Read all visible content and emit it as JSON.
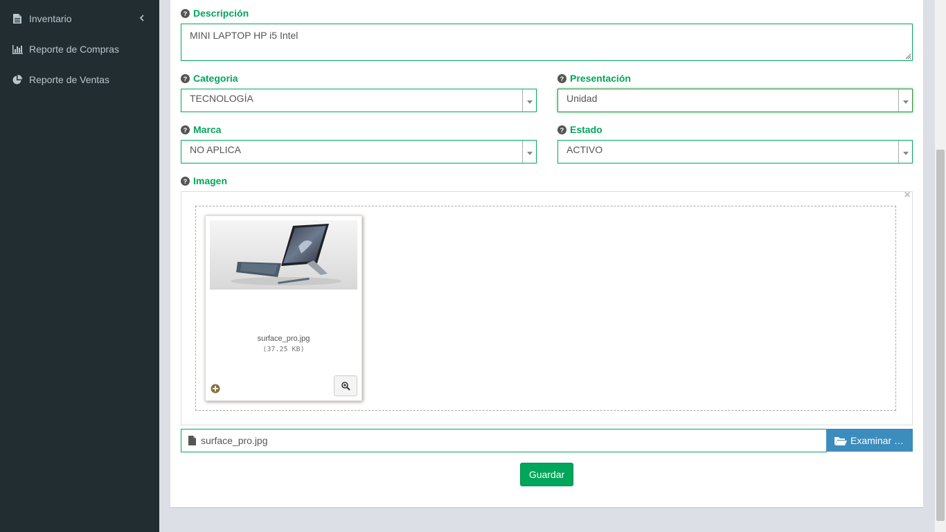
{
  "sidebar": {
    "items": [
      {
        "label": "Inventario",
        "icon": "file-text-icon"
      },
      {
        "label": "Reporte de Compras",
        "icon": "bar-chart-icon"
      },
      {
        "label": "Reporte de Ventas",
        "icon": "pie-chart-icon"
      }
    ]
  },
  "form": {
    "descripcion": {
      "label": "Descripción",
      "value": "MINI LAPTOP HP i5 Intel"
    },
    "categoria": {
      "label": "Categoria",
      "value": "TECNOLOGÍA"
    },
    "presentacion": {
      "label": "Presentación",
      "value": "Unidad"
    },
    "marca": {
      "label": "Marca",
      "value": "NO APLICA"
    },
    "estado": {
      "label": "Estado",
      "value": "ACTIVO"
    },
    "imagen": {
      "label": "Imagen"
    }
  },
  "preview": {
    "filename": "surface_pro.jpg",
    "filesize": "(37.25 KB)"
  },
  "file_input": {
    "caption": "surface_pro.jpg",
    "browse_label": "Examinar …"
  },
  "save_label": "Guardar",
  "colors": {
    "accent_green": "#00a65a",
    "browse_blue": "#3c8dbc",
    "sidebar_bg": "#222d32"
  }
}
